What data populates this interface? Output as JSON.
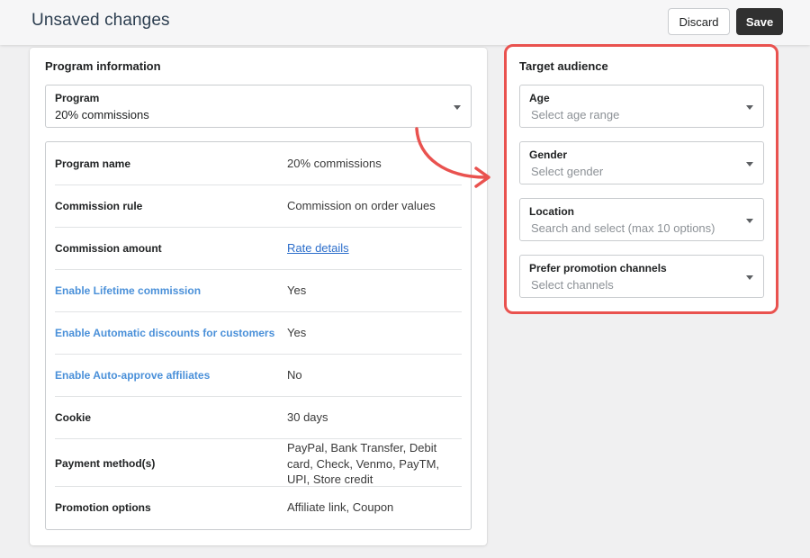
{
  "header": {
    "title": "Unsaved changes",
    "discard_label": "Discard",
    "save_label": "Save"
  },
  "program_info": {
    "title": "Program information",
    "program_select": {
      "label": "Program",
      "value": "20% commissions"
    },
    "rows": [
      {
        "key": "Program name",
        "value": "20% commissions",
        "key_style": "bold"
      },
      {
        "key": "Commission rule",
        "value": "Commission on order values",
        "key_style": "bold"
      },
      {
        "key": "Commission amount",
        "value": "Rate details",
        "key_style": "bold",
        "value_is_link": true
      },
      {
        "key": "Enable Lifetime commission",
        "value": "Yes",
        "key_style": "blue"
      },
      {
        "key": "Enable Automatic discounts for customers",
        "value": "Yes",
        "key_style": "blue"
      },
      {
        "key": "Enable Auto-approve affiliates",
        "value": "No",
        "key_style": "blue"
      },
      {
        "key": "Cookie",
        "value": "30 days",
        "key_style": "bold"
      },
      {
        "key": "Payment method(s)",
        "value": "PayPal, Bank Transfer, Debit card, Check, Venmo, PayTM, UPI, Store credit",
        "key_style": "bold"
      },
      {
        "key": "Promotion options",
        "value": "Affiliate link, Coupon",
        "key_style": "bold"
      }
    ]
  },
  "target_audience": {
    "title": "Target audience",
    "fields": [
      {
        "label": "Age",
        "placeholder": "Select age range"
      },
      {
        "label": "Gender",
        "placeholder": "Select gender"
      },
      {
        "label": "Location",
        "placeholder": "Search and select (max 10 options)"
      },
      {
        "label": "Prefer promotion channels",
        "placeholder": "Select channels"
      }
    ]
  },
  "colors": {
    "highlight_border": "#e9524f",
    "blue_label": "#4a90d9",
    "link": "#2c6ecb",
    "save_button": "#303030"
  },
  "icons": [
    "chevron-down-icon",
    "curved-arrow-icon"
  ]
}
